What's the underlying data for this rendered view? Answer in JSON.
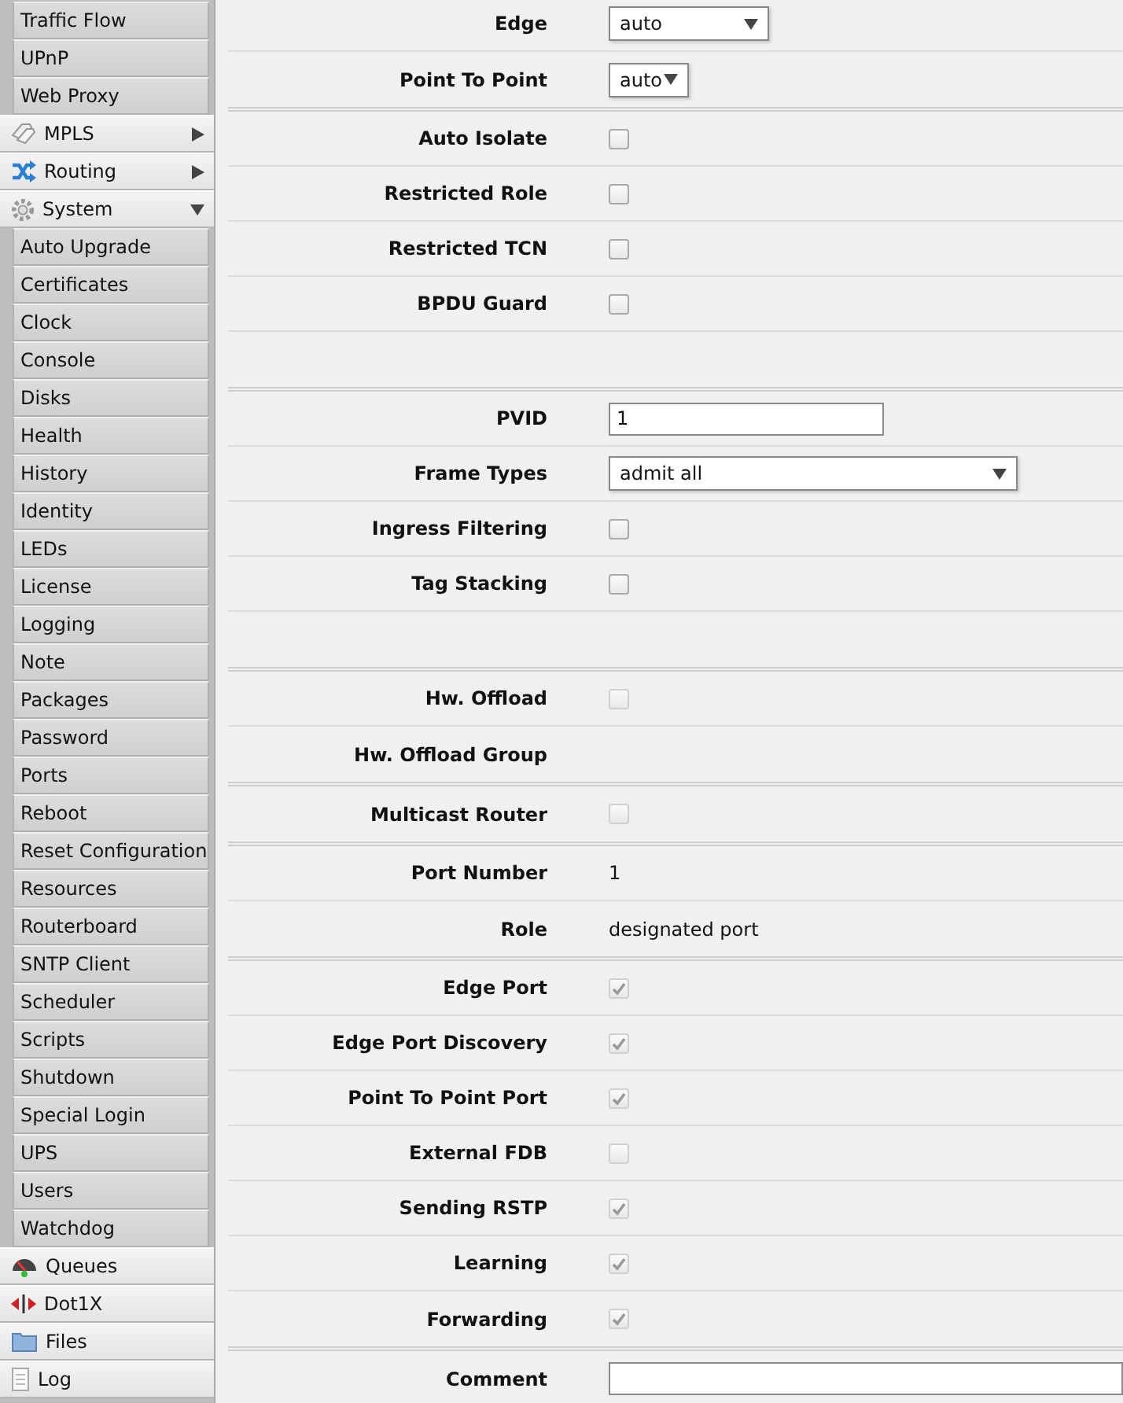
{
  "sidebar": {
    "items": [
      {
        "kind": "sub",
        "label": "Traffic Flow"
      },
      {
        "kind": "sub",
        "label": "UPnP"
      },
      {
        "kind": "sub",
        "label": "Web Proxy"
      },
      {
        "kind": "menu",
        "label": "MPLS",
        "expanded": false
      },
      {
        "kind": "menu",
        "label": "Routing",
        "expanded": false
      },
      {
        "kind": "menu",
        "label": "System",
        "expanded": true
      },
      {
        "kind": "sub",
        "label": "Auto Upgrade"
      },
      {
        "kind": "sub",
        "label": "Certificates"
      },
      {
        "kind": "sub",
        "label": "Clock"
      },
      {
        "kind": "sub",
        "label": "Console"
      },
      {
        "kind": "sub",
        "label": "Disks"
      },
      {
        "kind": "sub",
        "label": "Health"
      },
      {
        "kind": "sub",
        "label": "History"
      },
      {
        "kind": "sub",
        "label": "Identity"
      },
      {
        "kind": "sub",
        "label": "LEDs"
      },
      {
        "kind": "sub",
        "label": "License"
      },
      {
        "kind": "sub",
        "label": "Logging"
      },
      {
        "kind": "sub",
        "label": "Note"
      },
      {
        "kind": "sub",
        "label": "Packages"
      },
      {
        "kind": "sub",
        "label": "Password"
      },
      {
        "kind": "sub",
        "label": "Ports"
      },
      {
        "kind": "sub",
        "label": "Reboot"
      },
      {
        "kind": "sub",
        "label": "Reset Configuration"
      },
      {
        "kind": "sub",
        "label": "Resources"
      },
      {
        "kind": "sub",
        "label": "Routerboard"
      },
      {
        "kind": "sub",
        "label": "SNTP Client"
      },
      {
        "kind": "sub",
        "label": "Scheduler"
      },
      {
        "kind": "sub",
        "label": "Scripts"
      },
      {
        "kind": "sub",
        "label": "Shutdown"
      },
      {
        "kind": "sub",
        "label": "Special Login"
      },
      {
        "kind": "sub",
        "label": "UPS"
      },
      {
        "kind": "sub",
        "label": "Users"
      },
      {
        "kind": "sub",
        "label": "Watchdog"
      },
      {
        "kind": "menu",
        "label": "Queues"
      },
      {
        "kind": "menu",
        "label": "Dot1X"
      },
      {
        "kind": "menu",
        "label": "Files"
      },
      {
        "kind": "menu",
        "label": "Log"
      }
    ]
  },
  "form": {
    "sections": [
      {
        "rows": [
          {
            "kind": "select",
            "label": "Edge",
            "value": "auto"
          },
          {
            "kind": "select",
            "label": "Point To Point",
            "value": "auto"
          }
        ]
      },
      {
        "rows": [
          {
            "kind": "checkbox",
            "label": "Auto Isolate",
            "checked": false,
            "disabled": false
          },
          {
            "kind": "checkbox",
            "label": "Restricted Role",
            "checked": false,
            "disabled": false
          },
          {
            "kind": "checkbox",
            "label": "Restricted TCN",
            "checked": false,
            "disabled": false
          },
          {
            "kind": "checkbox",
            "label": "BPDU Guard",
            "checked": false,
            "disabled": false
          },
          {
            "kind": "spacer"
          }
        ]
      },
      {
        "rows": [
          {
            "kind": "input",
            "label": "PVID",
            "value": "1"
          },
          {
            "kind": "select",
            "label": "Frame Types",
            "value": "admit all"
          },
          {
            "kind": "checkbox",
            "label": "Ingress Filtering",
            "checked": false,
            "disabled": false
          },
          {
            "kind": "checkbox",
            "label": "Tag Stacking",
            "checked": false,
            "disabled": false
          },
          {
            "kind": "spacer"
          }
        ]
      },
      {
        "rows": [
          {
            "kind": "checkbox",
            "label": "Hw. Offload",
            "checked": false,
            "disabled": true
          },
          {
            "kind": "label",
            "label": "Hw. Offload Group"
          }
        ]
      },
      {
        "rows": [
          {
            "kind": "checkbox",
            "label": "Multicast Router",
            "checked": false,
            "disabled": true
          }
        ]
      },
      {
        "rows": [
          {
            "kind": "value",
            "label": "Port Number",
            "value": "1"
          },
          {
            "kind": "value",
            "label": "Role",
            "value": "designated port"
          }
        ]
      },
      {
        "rows": [
          {
            "kind": "checkbox",
            "label": "Edge Port",
            "checked": true,
            "disabled": true
          },
          {
            "kind": "checkbox",
            "label": "Edge Port Discovery",
            "checked": true,
            "disabled": true
          },
          {
            "kind": "checkbox",
            "label": "Point To Point Port",
            "checked": true,
            "disabled": true
          },
          {
            "kind": "checkbox",
            "label": "External FDB",
            "checked": false,
            "disabled": true
          },
          {
            "kind": "checkbox",
            "label": "Sending RSTP",
            "checked": true,
            "disabled": true
          },
          {
            "kind": "checkbox",
            "label": "Learning",
            "checked": true,
            "disabled": true
          },
          {
            "kind": "checkbox",
            "label": "Forwarding",
            "checked": true,
            "disabled": true
          }
        ]
      },
      {
        "rows": [
          {
            "kind": "input",
            "label": "Comment",
            "value": ""
          }
        ]
      }
    ]
  }
}
